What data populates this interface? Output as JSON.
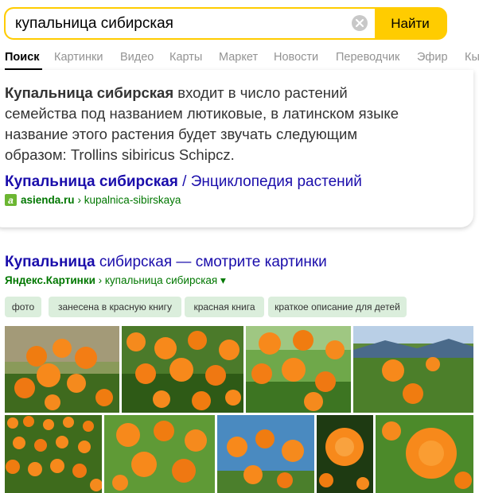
{
  "search": {
    "query": "купальница сибирская",
    "button_label": "Найти"
  },
  "tabs": [
    "Поиск",
    "Картинки",
    "Видео",
    "Карты",
    "Маркет",
    "Новости",
    "Переводчик",
    "Эфир",
    "Кы"
  ],
  "result1": {
    "snippet_bold": "Купальница сибирская",
    "snippet_rest": " входит в число растений семейства под названием лютиковые, в латинском языке название этого растения будет звучать следующим образом: Trollins sibiricus Schipcz.",
    "title_bold": "Купальница сибирская",
    "title_rest": " / Энциклопедия растений",
    "favicon_letter": "a",
    "domain": "asienda.ru",
    "path": "› kupalnica-sibirskaya"
  },
  "images": {
    "title_bold": "Купальница",
    "title_rest": " сибирская — смотрите картинки",
    "source_bold": "Яндекс.Картинки",
    "source_rest": " › купальница сибирская ▾",
    "chips": [
      "фото",
      "занесена в красную книгу",
      "красная книга",
      "краткое описание для детей"
    ]
  },
  "colors": {
    "search_border": "#ffcc00",
    "link": "#1a0dab",
    "url_green": "#007700",
    "chip_bg": "#dbeedc",
    "flower_orange": "#f7891b"
  }
}
